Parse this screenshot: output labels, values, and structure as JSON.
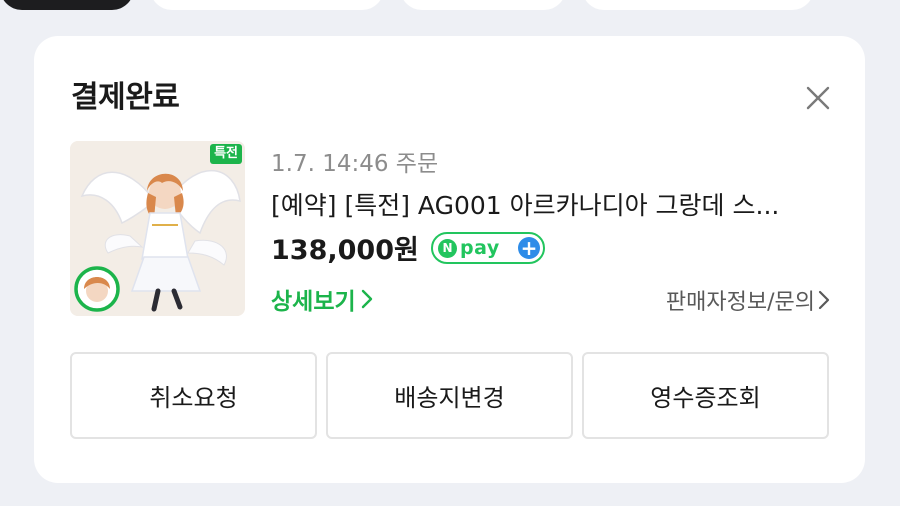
{
  "card": {
    "title": "결제완료",
    "close_icon": "close-icon"
  },
  "order": {
    "badge": "특전",
    "date": "1.7. 14:46 주문",
    "product_name": "[예약] [특전] AG001 아르카나디아 그랑데 스...",
    "price": "138,000원",
    "payment": {
      "n": "N",
      "label": "pay",
      "plus": "+",
      "colors": {
        "green": "#22c55e",
        "blue": "#2e8ce8"
      }
    },
    "detail_link": "상세보기",
    "seller_link": "판매자정보/문의"
  },
  "actions": [
    {
      "label": "취소요청"
    },
    {
      "label": "배송지변경"
    },
    {
      "label": "영수증조회"
    }
  ],
  "colors": {
    "background": "#eef0f5",
    "accent_green": "#1cb44b",
    "text": "#1a1a1a",
    "muted": "#8c8c8c"
  }
}
